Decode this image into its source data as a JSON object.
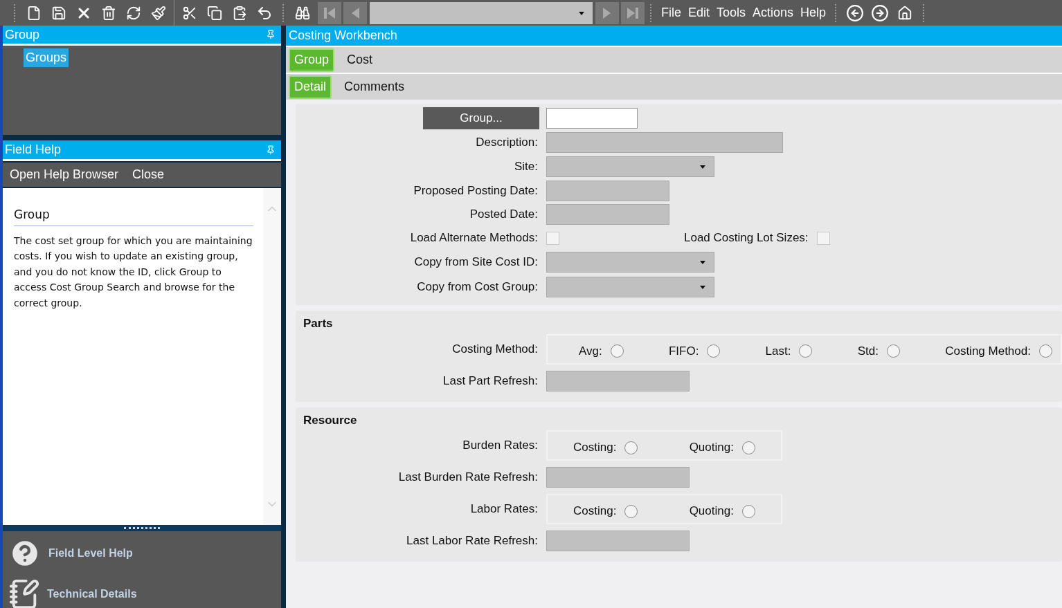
{
  "toolbar": {
    "menu": [
      "File",
      "Edit",
      "Tools",
      "Actions",
      "Help"
    ]
  },
  "group_panel": {
    "title": "Group",
    "tree": [
      {
        "label": "Groups",
        "selected": true
      }
    ]
  },
  "field_help": {
    "title": "Field Help",
    "actions": [
      "Open Help Browser",
      "Close"
    ],
    "heading": "Group",
    "body": "The cost set group for which you are maintaining costs. If you wish to update an existing group, and you do not know the ID, click Group to access Cost Group Search and browse for the correct group."
  },
  "bottom_nav": [
    {
      "kind": "help",
      "label": "Field Level Help"
    },
    {
      "kind": "details",
      "label": "Technical Details"
    }
  ],
  "main": {
    "title": "Costing Workbench",
    "tabs": [
      {
        "label": "Group",
        "selected": true
      },
      {
        "label": "Cost",
        "selected": false
      }
    ],
    "subtabs": [
      {
        "label": "Detail",
        "selected": true
      },
      {
        "label": "Comments",
        "selected": false
      }
    ],
    "sections": [
      {
        "rows": [
          {
            "kind": "lookup",
            "label": "Group..."
          },
          {
            "kind": "wide",
            "label": "Description:"
          },
          {
            "kind": "dropdown",
            "label": "Site:"
          },
          {
            "kind": "date",
            "label": "Proposed Posting Date:"
          },
          {
            "kind": "date",
            "label": "Posted Date:"
          },
          {
            "kind": "checks",
            "label": "Load Alternate Methods:",
            "checked": false,
            "second": {
              "label": "Load Costing Lot Sizes:",
              "checked": false
            }
          },
          {
            "kind": "dropdown",
            "label": "Copy from Site Cost ID:"
          },
          {
            "kind": "dropdown",
            "label": "Copy from Cost Group:"
          }
        ]
      },
      {
        "title": "Parts",
        "rows": [
          {
            "kind": "radios",
            "label": "Costing Method:",
            "options": [
              {
                "label": "Avg:",
                "selected": false
              },
              {
                "label": "FIFO:",
                "selected": false
              },
              {
                "label": "Last:",
                "selected": false
              },
              {
                "label": "Std:",
                "selected": false
              },
              {
                "label": "Costing Method:",
                "selected": false
              }
            ]
          },
          {
            "kind": "stamp",
            "label": "Last Part Refresh:"
          }
        ]
      },
      {
        "title": "Resource",
        "rows": [
          {
            "kind": "radios",
            "label": "Burden Rates:",
            "options": [
              {
                "label": "Costing:",
                "selected": false
              },
              {
                "label": "Quoting:",
                "selected": false
              }
            ]
          },
          {
            "kind": "stamp",
            "label": "Last Burden Rate Refresh:"
          },
          {
            "kind": "radios",
            "label": "Labor Rates:",
            "options": [
              {
                "label": "Costing:",
                "selected": false
              },
              {
                "label": "Quoting:",
                "selected": false
              }
            ]
          },
          {
            "kind": "stamp",
            "label": "Last Labor Rate Refresh:"
          }
        ]
      }
    ]
  }
}
